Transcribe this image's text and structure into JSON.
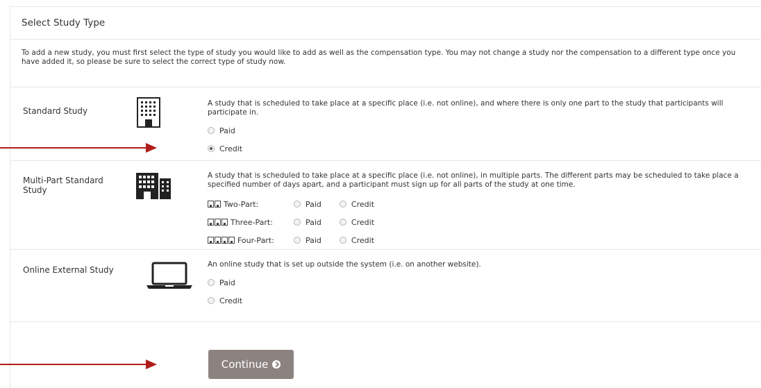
{
  "header": {
    "title": "Select Study Type"
  },
  "intro": {
    "text": "To add a new study, you must first select the type of study you would like to add as well as the compensation type. You may not change a study nor the compensation to a different type once you have added it, so please be sure to select the correct type of study now."
  },
  "standard": {
    "title": "Standard Study",
    "icon": "building-icon",
    "description": "A study that is scheduled to take place at a specific place (i.e. not online), and where there is only one part to the study that participants will participate in.",
    "options": [
      {
        "label": "Paid",
        "checked": false
      },
      {
        "label": "Credit",
        "checked": true
      }
    ]
  },
  "multipart": {
    "title": "Multi-Part Standard Study",
    "icon": "buildings-icon",
    "description": "A study that is scheduled to take place at a specific place (i.e. not online), in multiple parts. The different parts may be scheduled to take place a specified number of days apart, and a participant must sign up for all parts of the study at one time.",
    "parts": [
      {
        "label": "Two-Part:",
        "paid": "Paid",
        "credit": "Credit"
      },
      {
        "label": "Three-Part:",
        "paid": "Paid",
        "credit": "Credit"
      },
      {
        "label": "Four-Part:",
        "paid": "Paid",
        "credit": "Credit"
      }
    ]
  },
  "online": {
    "title": "Online External Study",
    "icon": "laptop-icon",
    "description": "An online study that is set up outside the system (i.e. on another website).",
    "options": [
      {
        "label": "Paid",
        "checked": false
      },
      {
        "label": "Credit",
        "checked": false
      }
    ]
  },
  "continue_label": "Continue",
  "colors": {
    "button": "#8c8380",
    "annotation_arrow": "#b01c1c"
  }
}
